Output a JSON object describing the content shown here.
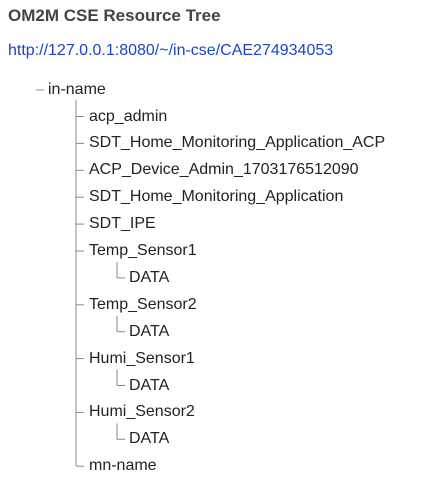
{
  "page": {
    "title": "OM2M CSE Resource Tree",
    "url": "http://127.0.0.1:8080/~/in-cse/CAE274934053"
  },
  "tree": {
    "root": "in-name",
    "children": [
      {
        "label": "acp_admin",
        "children": []
      },
      {
        "label": "SDT_Home_Monitoring_Application_ACP",
        "children": []
      },
      {
        "label": "ACP_Device_Admin_1703176512090",
        "children": []
      },
      {
        "label": "SDT_Home_Monitoring_Application",
        "children": []
      },
      {
        "label": "SDT_IPE",
        "children": []
      },
      {
        "label": "Temp_Sensor1",
        "children": [
          "DATA"
        ]
      },
      {
        "label": "Temp_Sensor2",
        "children": [
          "DATA"
        ]
      },
      {
        "label": "Humi_Sensor1",
        "children": [
          "DATA"
        ]
      },
      {
        "label": "Humi_Sensor2",
        "children": [
          "DATA"
        ]
      },
      {
        "label": "mn-name",
        "children": []
      }
    ]
  },
  "colors": {
    "link": "#1a45c8",
    "tree_lines": "#888888",
    "title": "#444444"
  }
}
